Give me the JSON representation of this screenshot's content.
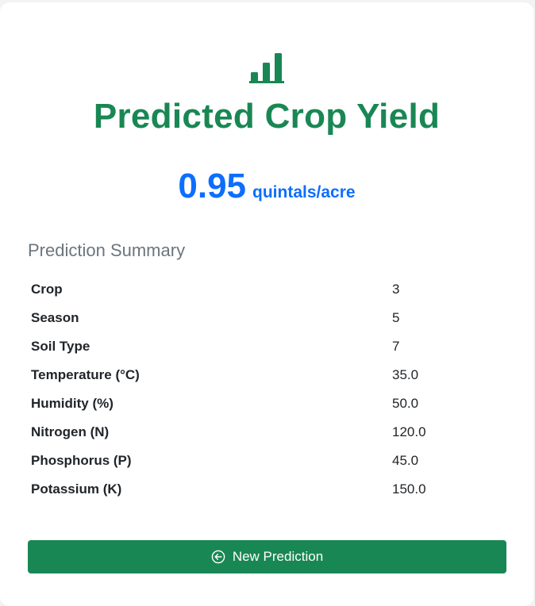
{
  "header": {
    "icon": "bar-chart-icon",
    "title": "Predicted Crop Yield",
    "accent_color": "#198754"
  },
  "result": {
    "value": "0.95",
    "unit": "quintals/acre",
    "color": "#0d6efd"
  },
  "summary": {
    "heading": "Prediction Summary",
    "rows": [
      {
        "label": "Crop",
        "value": "3"
      },
      {
        "label": "Season",
        "value": "5"
      },
      {
        "label": "Soil Type",
        "value": "7"
      },
      {
        "label": "Temperature (°C)",
        "value": "35.0"
      },
      {
        "label": "Humidity (%)",
        "value": "50.0"
      },
      {
        "label": "Nitrogen (N)",
        "value": "120.0"
      },
      {
        "label": "Phosphorus (P)",
        "value": "45.0"
      },
      {
        "label": "Potassium (K)",
        "value": "150.0"
      }
    ]
  },
  "actions": {
    "new_prediction_label": "New Prediction",
    "new_prediction_icon": "arrow-left-circle-icon"
  }
}
